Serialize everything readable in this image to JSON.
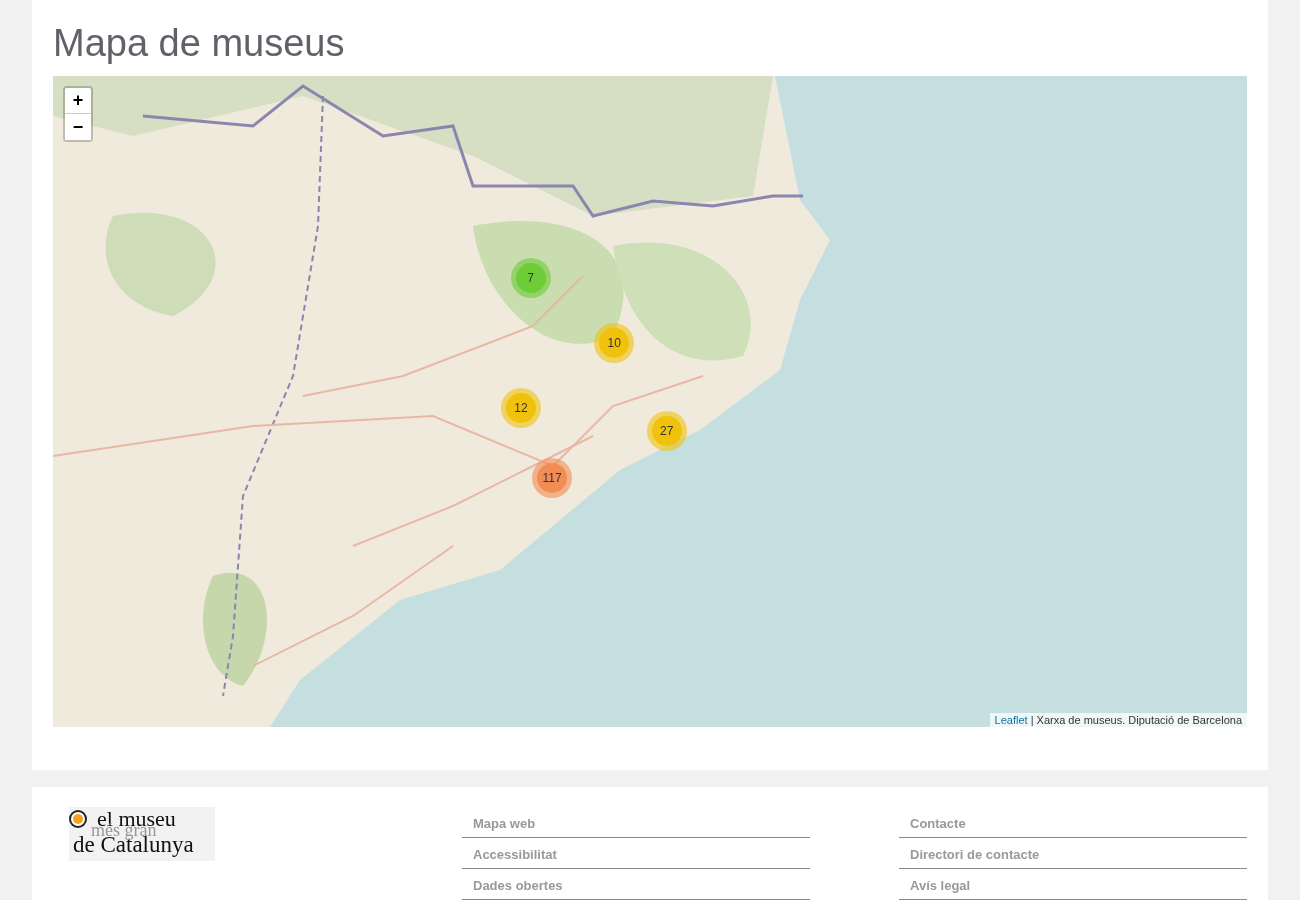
{
  "title": "Mapa de museus",
  "map": {
    "zoom_in": "+",
    "zoom_out": "−",
    "attribution_link": "Leaflet",
    "attribution_text": " | Xarxa de museus. Diputació de Barcelona",
    "clusters": [
      {
        "count": "7",
        "color": "#6ecc39"
      },
      {
        "count": "10",
        "color": "#f0c20c"
      },
      {
        "count": "12",
        "color": "#f0c20c"
      },
      {
        "count": "27",
        "color": "#f0c20c"
      },
      {
        "count": "117",
        "color": "#f18c54"
      }
    ]
  },
  "footer": {
    "logo": {
      "line_1": "el museu",
      "line_2": "més gran",
      "line_3": "de Catalunya"
    },
    "links": [
      [
        "Mapa web",
        "Accessibilitat",
        "Dades obertes"
      ],
      [
        "Contacte",
        "Directori de contacte",
        "Avís legal"
      ]
    ]
  }
}
